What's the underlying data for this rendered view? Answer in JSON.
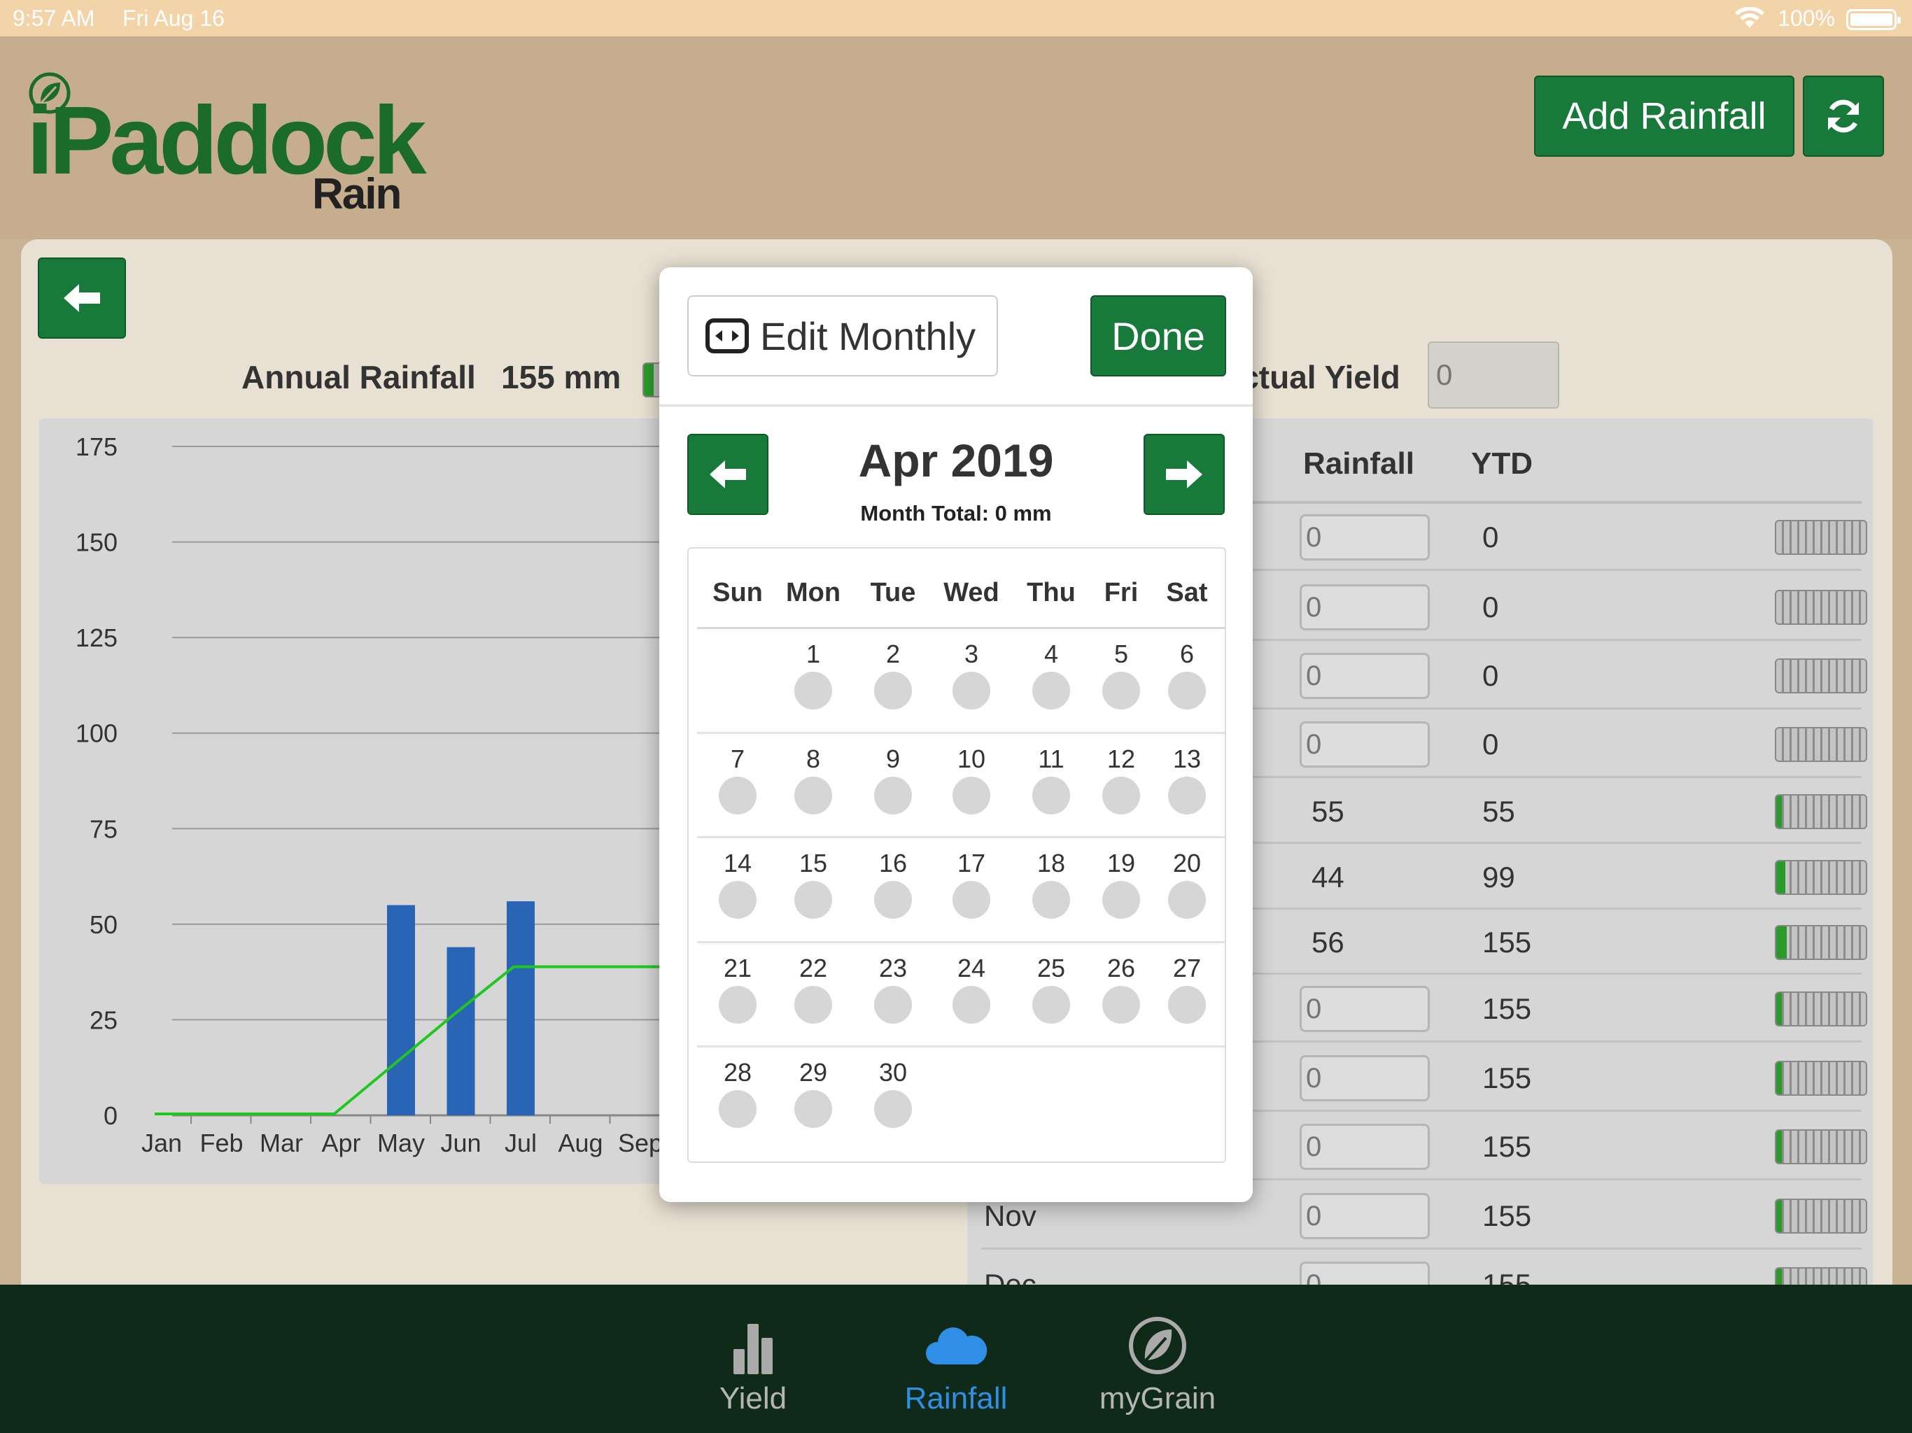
{
  "status_bar": {
    "time": "9:57 AM",
    "date": "Fri Aug 16",
    "battery": "100%"
  },
  "logo": {
    "main": "iPaddock",
    "sub": "Rain"
  },
  "header": {
    "add_rainfall_label": "Add Rainfall"
  },
  "summary": {
    "annual_label": "Annual Rainfall",
    "annual_value": "155 mm",
    "yield_label": "Actual Yield",
    "yield_placeholder": "0"
  },
  "chart_data": {
    "type": "bar",
    "categories": [
      "Jan",
      "Feb",
      "Mar",
      "Apr",
      "May",
      "Jun",
      "Jul",
      "Aug",
      "Sep"
    ],
    "values": [
      0,
      0,
      0,
      0,
      55,
      44,
      56,
      0,
      0
    ],
    "cumulative_line": [
      0,
      0,
      0,
      0,
      13,
      26,
      38.5,
      38.5,
      38.5
    ],
    "yticks": [
      0,
      25,
      50,
      75,
      100,
      125,
      150,
      175
    ],
    "ylim": [
      0,
      175
    ],
    "title": "",
    "xlabel": "",
    "ylabel": "",
    "grid": true,
    "colors": {
      "bar": "#2a64b4",
      "line": "#1ec81e"
    }
  },
  "table": {
    "headers": {
      "rainfall": "Rainfall",
      "ytd": "YTD"
    },
    "rows": [
      {
        "month": "",
        "rain": "",
        "ytd": "0",
        "input": true,
        "fill": 0
      },
      {
        "month": "",
        "rain": "",
        "ytd": "0",
        "input": true,
        "fill": 0
      },
      {
        "month": "",
        "rain": "",
        "ytd": "0",
        "input": true,
        "fill": 0
      },
      {
        "month": "",
        "rain": "",
        "ytd": "0",
        "input": true,
        "fill": 0
      },
      {
        "month": "",
        "rain": "55",
        "ytd": "55",
        "input": false,
        "fill": 0.06
      },
      {
        "month": "",
        "rain": "44",
        "ytd": "99",
        "input": false,
        "fill": 0.1
      },
      {
        "month": "",
        "rain": "56",
        "ytd": "155",
        "input": false,
        "fill": 0.12
      },
      {
        "month": "",
        "rain": "",
        "ytd": "155",
        "input": true,
        "fill": 0.06
      },
      {
        "month": "",
        "rain": "",
        "ytd": "155",
        "input": true,
        "fill": 0.06
      },
      {
        "month": "",
        "rain": "",
        "ytd": "155",
        "input": true,
        "fill": 0.06
      },
      {
        "month": "Nov",
        "rain": "",
        "ytd": "155",
        "input": true,
        "fill": 0.06
      },
      {
        "month": "Dec",
        "rain": "",
        "ytd": "155",
        "input": true,
        "fill": 0.06
      }
    ],
    "input_placeholder": "0"
  },
  "popover": {
    "edit_monthly_label": "Edit Monthly",
    "done_label": "Done",
    "month_title": "Apr 2019",
    "month_total": "Month Total: 0 mm",
    "weekdays": [
      "Sun",
      "Mon",
      "Tue",
      "Wed",
      "Thu",
      "Fri",
      "Sat"
    ],
    "first_weekday": 1,
    "days_in_month": 30
  },
  "tabs": [
    {
      "label": "Yield",
      "icon": "bar-chart-icon",
      "active": false
    },
    {
      "label": "Rainfall",
      "icon": "cloud-icon",
      "active": true
    },
    {
      "label": "myGrain",
      "icon": "leaf-icon",
      "active": false
    }
  ],
  "colors": {
    "brand_green": "#17793a",
    "active_tab": "#2f8fe6",
    "tab_bar": "#0f2a18"
  }
}
